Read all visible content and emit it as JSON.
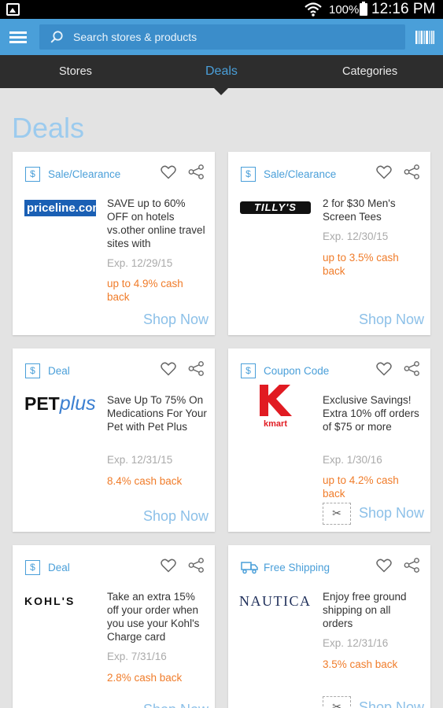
{
  "status_bar": {
    "battery": "100%",
    "time": "12:16 PM"
  },
  "search": {
    "placeholder": "Search stores & products"
  },
  "tabs": [
    {
      "label": "Stores"
    },
    {
      "label": "Deals"
    },
    {
      "label": "Categories"
    }
  ],
  "page_title": "Deals",
  "deals": [
    {
      "type": "Sale/Clearance",
      "type_icon": "dollar-icon",
      "store_logo": "priceline.com",
      "description": "SAVE up to 60% OFF on hotels vs.other online travel sites with",
      "expiry": "Exp. 12/29/15",
      "cashback": "up to 4.9% cash back",
      "action": "Shop Now"
    },
    {
      "type": "Sale/Clearance",
      "type_icon": "dollar-icon",
      "store_logo": "TILLY'S",
      "description": "2 for $30 Men's Screen Tees",
      "expiry": "Exp. 12/30/15",
      "cashback": "up to 3.5% cash back",
      "action": "Shop Now"
    },
    {
      "type": "Deal",
      "type_icon": "dollar-icon",
      "store_logo_1": "PET",
      "store_logo_2": "plus",
      "description": "Save Up To 75% On Medications For Your Pet with Pet Plus",
      "expiry": "Exp. 12/31/15",
      "cashback": "8.4% cash back",
      "action": "Shop Now"
    },
    {
      "type": "Coupon Code",
      "type_icon": "dollar-icon",
      "store_logo": "kmart",
      "description": "Exclusive Savings! Extra 10% off orders of $75 or more",
      "expiry": "Exp. 1/30/16",
      "cashback": "up to 4.2% cash back",
      "action": "Shop Now"
    },
    {
      "type": "Deal",
      "type_icon": "dollar-icon",
      "store_logo": "KOHL'S",
      "description": "Take an extra 15% off your order when you use your Kohl's Charge card",
      "expiry": "Exp. 7/31/16",
      "cashback": "2.8% cash back",
      "action": "Shop Now"
    },
    {
      "type": "Free Shipping",
      "type_icon": "truck-icon",
      "store_logo": "NAUTICA",
      "description": "Enjoy free ground shipping on all orders",
      "expiry": "Exp. 12/31/16",
      "cashback": "3.5% cash back",
      "action": "Shop Now"
    }
  ],
  "colors": {
    "accent": "#4a9fd9",
    "cashback": "#f07c2a",
    "tab_bar": "#2d2d2d",
    "background": "#e3e3e3"
  }
}
